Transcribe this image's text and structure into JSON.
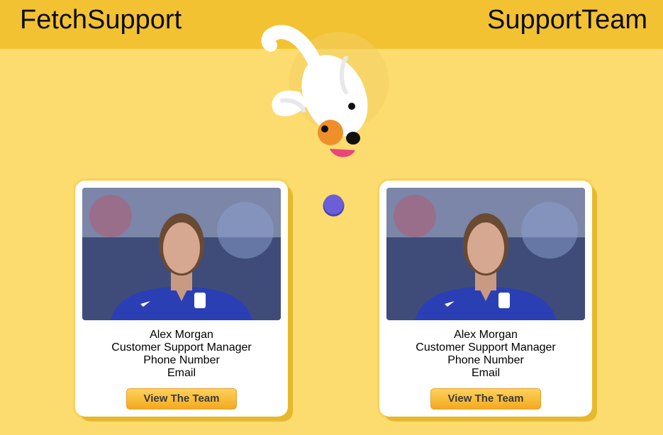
{
  "header": {
    "brand": "FetchSupport",
    "section_title": "SupportTeam"
  },
  "colors": {
    "page_background": "#fcdb6f",
    "header_background": "#f2c233",
    "button_gradient_top": "#ffd15a",
    "button_gradient_bottom": "#f3a91f",
    "ball": "#6a5fd8"
  },
  "mascot": {
    "icon": "dog-mascot-icon"
  },
  "ball": {
    "icon": "ball-icon"
  },
  "cards": [
    {
      "photo": "player-photo",
      "name": "Alex Morgan",
      "role": "Customer Support Manager",
      "phone": "Phone Number",
      "email": "Email",
      "button": "View The Team"
    },
    {
      "photo": "player-photo",
      "name": "Alex Morgan",
      "role": "Customer Support Manager",
      "phone": "Phone Number",
      "email": "Email",
      "button": "View The Team"
    }
  ]
}
